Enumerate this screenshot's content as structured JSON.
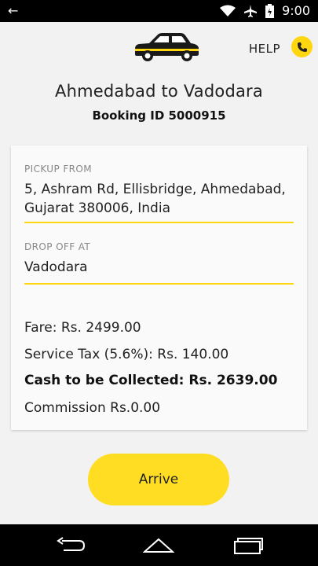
{
  "status": {
    "time": "9:00",
    "back_icon": "arrow-left-icon"
  },
  "header": {
    "help_label": "HELP",
    "help_icon": "phone-icon",
    "accent": "#ffd60f"
  },
  "trip": {
    "route": "Ahmedabad to Vadodara",
    "booking_id": "Booking ID 5000915"
  },
  "card": {
    "pickup_label": "PICKUP FROM",
    "pickup_value": "5, Ashram Rd, Ellisbridge, Ahmedabad, Gujarat 380006, India",
    "drop_label": "DROP OFF AT",
    "drop_value": "Vadodara",
    "fare": "Fare: Rs. 2499.00",
    "service_tax": "Service Tax (5.6%): Rs. 140.00",
    "cash": "Cash to be Collected: Rs. 2639.00",
    "commission": "Commission Rs.0.00"
  },
  "actions": {
    "arrive_label": "Arrive"
  }
}
